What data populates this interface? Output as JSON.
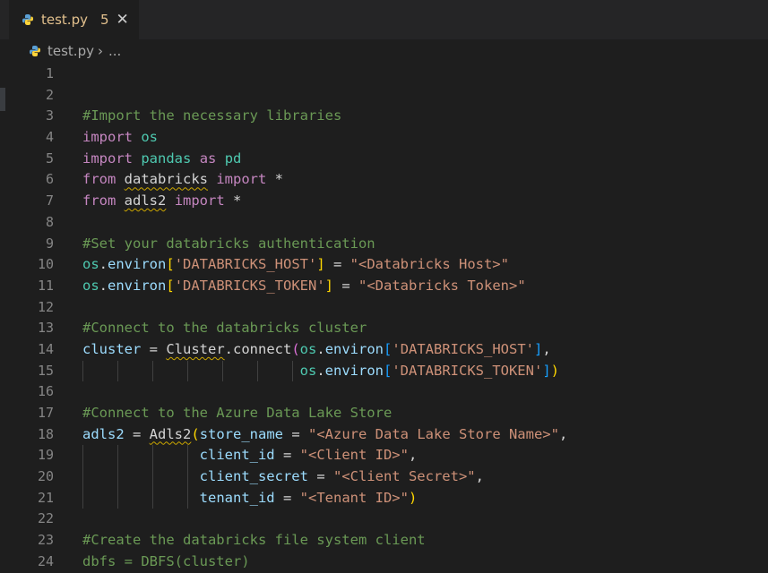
{
  "tab": {
    "filename": "test.py",
    "problem_count": "5",
    "close_glyph": "✕"
  },
  "breadcrumb": {
    "file": "test.py",
    "separator": "›",
    "more": "..."
  },
  "editor": {
    "line_numbers": [
      "1",
      "2",
      "3",
      "4",
      "5",
      "6",
      "7",
      "8",
      "9",
      "10",
      "11",
      "12",
      "13",
      "14",
      "15",
      "16",
      "17",
      "18",
      "19",
      "20",
      "21",
      "22",
      "23",
      "24"
    ],
    "lines": [
      [],
      [],
      [
        {
          "t": "#Import the necessary libraries",
          "c": "comment"
        }
      ],
      [
        {
          "t": "import",
          "c": "kw"
        },
        {
          "t": " ",
          "c": "plain"
        },
        {
          "t": "os",
          "c": "cls"
        }
      ],
      [
        {
          "t": "import",
          "c": "kw"
        },
        {
          "t": " ",
          "c": "plain"
        },
        {
          "t": "pandas",
          "c": "cls"
        },
        {
          "t": " ",
          "c": "plain"
        },
        {
          "t": "as",
          "c": "kw"
        },
        {
          "t": " ",
          "c": "plain"
        },
        {
          "t": "pd",
          "c": "cls"
        }
      ],
      [
        {
          "t": "from",
          "c": "kw"
        },
        {
          "t": " ",
          "c": "plain"
        },
        {
          "t": "databricks",
          "c": "plain",
          "sq": true
        },
        {
          "t": " ",
          "c": "plain"
        },
        {
          "t": "import",
          "c": "kw"
        },
        {
          "t": " *",
          "c": "plain"
        }
      ],
      [
        {
          "t": "from",
          "c": "kw"
        },
        {
          "t": " ",
          "c": "plain"
        },
        {
          "t": "adls2",
          "c": "plain",
          "sq": true
        },
        {
          "t": " ",
          "c": "plain"
        },
        {
          "t": "import",
          "c": "kw"
        },
        {
          "t": " *",
          "c": "plain"
        }
      ],
      [],
      [
        {
          "t": "#Set your databricks authentication",
          "c": "comment"
        }
      ],
      [
        {
          "t": "os",
          "c": "cls"
        },
        {
          "t": ".",
          "c": "plain"
        },
        {
          "t": "environ",
          "c": "var"
        },
        {
          "t": "[",
          "c": "br1"
        },
        {
          "t": "'DATABRICKS_HOST'",
          "c": "str"
        },
        {
          "t": "]",
          "c": "br1"
        },
        {
          "t": " = ",
          "c": "plain"
        },
        {
          "t": "\"<Databricks Host>\"",
          "c": "str"
        }
      ],
      [
        {
          "t": "os",
          "c": "cls"
        },
        {
          "t": ".",
          "c": "plain"
        },
        {
          "t": "environ",
          "c": "var"
        },
        {
          "t": "[",
          "c": "br1"
        },
        {
          "t": "'DATABRICKS_TOKEN'",
          "c": "str"
        },
        {
          "t": "]",
          "c": "br1"
        },
        {
          "t": " = ",
          "c": "plain"
        },
        {
          "t": "\"<Databricks Token>\"",
          "c": "str"
        }
      ],
      [],
      [
        {
          "t": "#Connect to the databricks cluster",
          "c": "comment"
        }
      ],
      [
        {
          "t": "cluster",
          "c": "var"
        },
        {
          "t": " = ",
          "c": "plain"
        },
        {
          "t": "Cluster",
          "c": "plain",
          "sq": true
        },
        {
          "t": ".",
          "c": "plain"
        },
        {
          "t": "connect",
          "c": "plain"
        },
        {
          "t": "(",
          "c": "br2"
        },
        {
          "t": "os",
          "c": "cls"
        },
        {
          "t": ".",
          "c": "plain"
        },
        {
          "t": "environ",
          "c": "var"
        },
        {
          "t": "[",
          "c": "br3"
        },
        {
          "t": "'DATABRICKS_HOST'",
          "c": "str"
        },
        {
          "t": "]",
          "c": "br3"
        },
        {
          "t": ",",
          "c": "plain"
        }
      ],
      [
        {
          "t": "                          ",
          "c": "plain"
        },
        {
          "t": "os",
          "c": "cls"
        },
        {
          "t": ".",
          "c": "plain"
        },
        {
          "t": "environ",
          "c": "var"
        },
        {
          "t": "[",
          "c": "br3"
        },
        {
          "t": "'DATABRICKS_TOKEN'",
          "c": "str"
        },
        {
          "t": "]",
          "c": "br3"
        },
        {
          "t": ")",
          "c": "br1"
        }
      ],
      [],
      [
        {
          "t": "#Connect to the Azure Data Lake Store",
          "c": "comment"
        }
      ],
      [
        {
          "t": "adls2",
          "c": "var"
        },
        {
          "t": " = ",
          "c": "plain"
        },
        {
          "t": "Adls2",
          "c": "plain",
          "sq": true
        },
        {
          "t": "(",
          "c": "br1"
        },
        {
          "t": "store_name",
          "c": "var"
        },
        {
          "t": " = ",
          "c": "plain"
        },
        {
          "t": "\"<Azure Data Lake Store Name>\"",
          "c": "str"
        },
        {
          "t": ",",
          "c": "plain"
        }
      ],
      [
        {
          "t": "              ",
          "c": "plain"
        },
        {
          "t": "client_id",
          "c": "var"
        },
        {
          "t": " = ",
          "c": "plain"
        },
        {
          "t": "\"<Client ID>\"",
          "c": "str"
        },
        {
          "t": ",",
          "c": "plain"
        }
      ],
      [
        {
          "t": "              ",
          "c": "plain"
        },
        {
          "t": "client_secret",
          "c": "var"
        },
        {
          "t": " = ",
          "c": "plain"
        },
        {
          "t": "\"<Client Secret>\"",
          "c": "str"
        },
        {
          "t": ",",
          "c": "plain"
        }
      ],
      [
        {
          "t": "              ",
          "c": "plain"
        },
        {
          "t": "tenant_id",
          "c": "var"
        },
        {
          "t": " = ",
          "c": "plain"
        },
        {
          "t": "\"<Tenant ID>\"",
          "c": "str"
        },
        {
          "t": ")",
          "c": "br1"
        }
      ],
      [],
      [
        {
          "t": "#Create the databricks file system client",
          "c": "comment"
        }
      ],
      [
        {
          "t": "dbfs = DBFS(cluster)",
          "c": "comment"
        }
      ]
    ]
  },
  "theme": {
    "background": "#1e1e1e",
    "tab_modified_color": "#e2c08d",
    "python_icon": "python-icon"
  }
}
